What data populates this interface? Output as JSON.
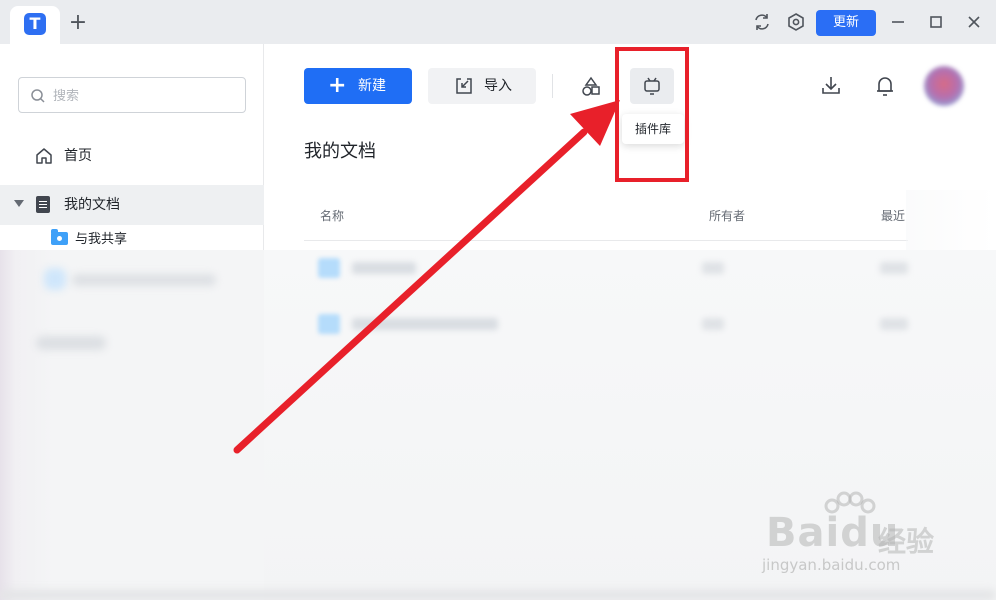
{
  "titlebar": {
    "app_logo": "T",
    "new_tab_icon": "plus-icon",
    "update_label": "更新",
    "icons": [
      "refresh-icon",
      "settings-icon",
      "minimize-icon",
      "maximize-icon",
      "close-icon"
    ],
    "accent": "#2a6ef5"
  },
  "sidebar": {
    "search_placeholder": "搜索",
    "items": [
      {
        "label": "首页",
        "icon": "home-icon"
      },
      {
        "label": "我的文档",
        "icon": "document-icon",
        "expanded": true,
        "selected": true
      },
      {
        "label": "与我共享",
        "icon": "shared-folder-icon"
      }
    ]
  },
  "toolbar": {
    "new_label": "新建",
    "import_label": "导入",
    "shapes_icon": "shapes-icon",
    "plugin_icon": "plugin-icon",
    "plugin_tooltip": "插件库",
    "download_icon": "download-icon",
    "bell_icon": "bell-icon",
    "avatar": "user-avatar"
  },
  "main": {
    "title": "我的文档",
    "columns": [
      "名称",
      "所有者",
      "最近"
    ]
  },
  "annotation": {
    "color": "#e8202a"
  },
  "watermark": {
    "brand": "Baidu",
    "brand_cn": "经验",
    "url": "jingyan.baidu.com"
  }
}
